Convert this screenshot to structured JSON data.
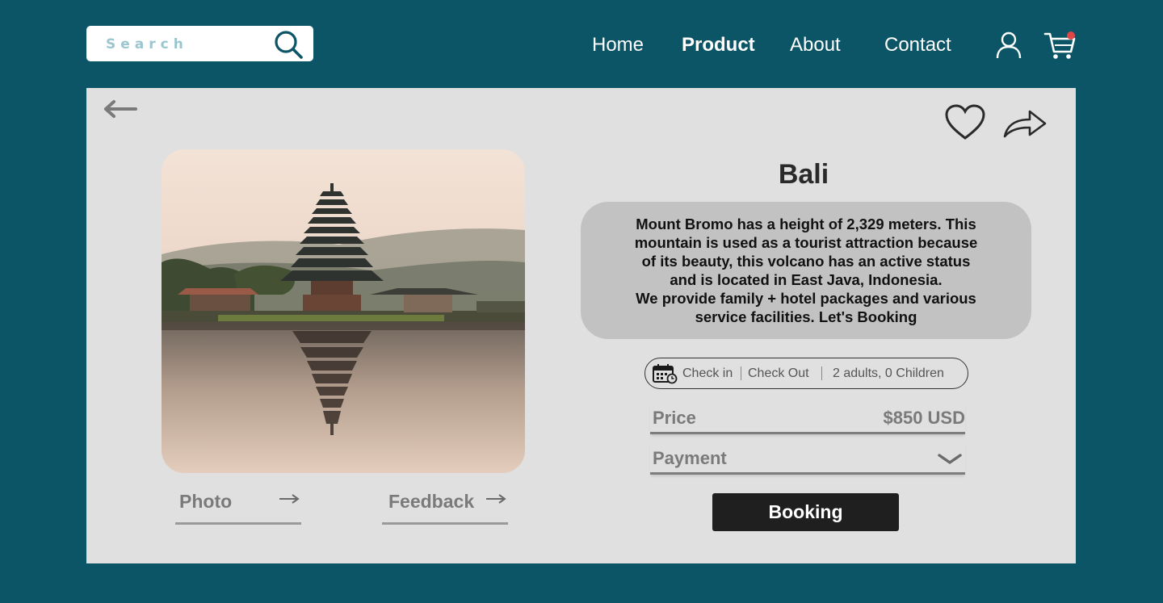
{
  "header": {
    "search": {
      "placeholder": "Search"
    },
    "nav": [
      {
        "label": "Home",
        "active": false
      },
      {
        "label": "Product",
        "active": true
      },
      {
        "label": "About",
        "active": false
      },
      {
        "label": "Contact",
        "active": false
      }
    ],
    "icons": {
      "search": "search-icon",
      "user": "user-icon",
      "cart": "cart-icon"
    },
    "cart_badge_color": "#e04646"
  },
  "product": {
    "title": "Bali",
    "description": [
      "Mount Bromo has a height of 2,329 meters. This",
      "mountain is used as a tourist attraction because",
      "of its beauty, this volcano has an active status",
      "and is located in East Java, Indonesia.",
      "We provide family + hotel packages and various",
      "service facilities. Let's Booking"
    ],
    "booking": {
      "check_in": "Check in",
      "check_out": "Check Out",
      "guests": "2 adults, 0 Children"
    },
    "price_label": "Price",
    "price_value": "$850 USD",
    "payment_label": "Payment",
    "booking_button": "Booking",
    "links": {
      "photo": "Photo",
      "feedback": "Feedback"
    }
  },
  "colors": {
    "background": "#0c5566",
    "card": "#e0e0e0",
    "description_bg": "#c2c2c2",
    "button": "#1f1f1f"
  }
}
